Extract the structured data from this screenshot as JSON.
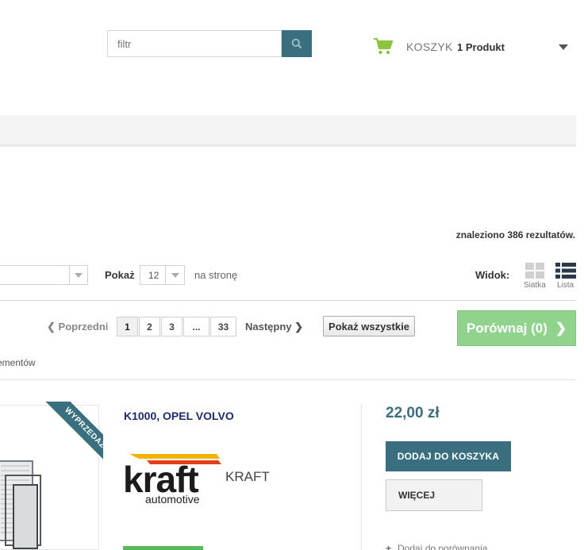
{
  "header": {
    "search_placeholder": "filtr",
    "cart_label": "KOSZYK",
    "cart_count": "1 Produkt"
  },
  "listing": {
    "results_text": "znaleziono 386 rezultatów.",
    "show_label": "Pokaż",
    "per_page_value": "12",
    "per_page_suffix": "na stronę",
    "view_label": "Widok:",
    "view_grid": "Siatka",
    "view_list": "Lista",
    "elements_text": "ementów"
  },
  "pagination": {
    "prev": "Poprzedni",
    "pages": [
      "1",
      "2",
      "3",
      "...",
      "33"
    ],
    "current_page": "1",
    "next": "Następny",
    "show_all": "Pokaż wszystkie",
    "compare": "Porównaj (0)"
  },
  "product": {
    "badge": "WYPRZEDAŻ!",
    "title": "K1000, OPEL VOLVO",
    "brand_logo_text": "kraft",
    "brand_logo_sub": "automotive",
    "brand_name": "KRAFT",
    "price": "22,00 zł",
    "add_to_cart": "DODAJ DO KOSZYKA",
    "more": "WIĘCEJ",
    "add_compare": "Dodaj do porównania"
  },
  "colors": {
    "accent": "#3a6f7f",
    "compare_green": "#8fd38d",
    "cart_green": "#8cc43f",
    "title_navy": "#1e2a6e"
  }
}
